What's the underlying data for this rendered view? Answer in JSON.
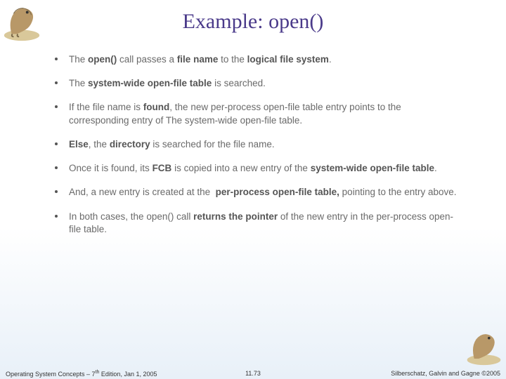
{
  "title": "Example: open()",
  "bullets": [
    "The <b>open()</b> call passes a <b>file name</b> to the <b>logical file system</b>.",
    "The <b>system-wide open-file table</b> is searched.",
    "If the file name is <b>found</b>, the new per-process open-file table entry points to the corresponding entry of The system-wide open-file table.",
    "<b>Else</b>, the <b>directory</b> is searched for the file name.",
    "Once it is found, its <b>FCB</b> is copied into a new entry of the <b>system-wide open-file table</b>.",
    "And, a new entry is created at the &nbsp;<b>per-process open-file table,</b> pointing to the entry above.",
    "In both cases, the open() call <b>returns the pointer</b> of the new entry in the per-process open-file table."
  ],
  "footer": {
    "left_a": "Operating System Concepts – 7",
    "left_sup": "th",
    "left_b": " Edition, Jan 1, 2005",
    "center": "11.73",
    "right": "Silberschatz, Galvin and Gagne ©2005"
  }
}
